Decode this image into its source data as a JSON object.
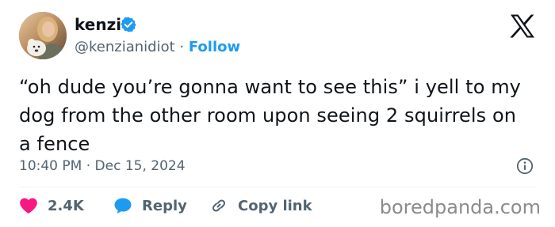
{
  "author": {
    "display_name": "kenzi",
    "handle": "@kenzianidiot",
    "separator": "·",
    "follow_label": "Follow",
    "verified": true
  },
  "tweet": {
    "text": "“oh dude you’re gonna want to see this” i yell to my dog from the other room upon seeing 2 squirrels on a fence",
    "timestamp": "10:40 PM · Dec 15, 2024"
  },
  "actions": {
    "like_count": "2.4K",
    "reply_label": "Reply",
    "copy_link_label": "Copy link"
  },
  "watermark": "boredpanda.com",
  "icons": {
    "logo": "x-logo-icon",
    "verified": "verified-badge-icon",
    "info": "info-icon",
    "like": "heart-icon",
    "reply": "speech-bubble-icon",
    "copy": "link-icon"
  },
  "colors": {
    "accent": "#1d9bf0",
    "text": "#0f1419",
    "muted": "#536471",
    "like": "#f91880"
  }
}
